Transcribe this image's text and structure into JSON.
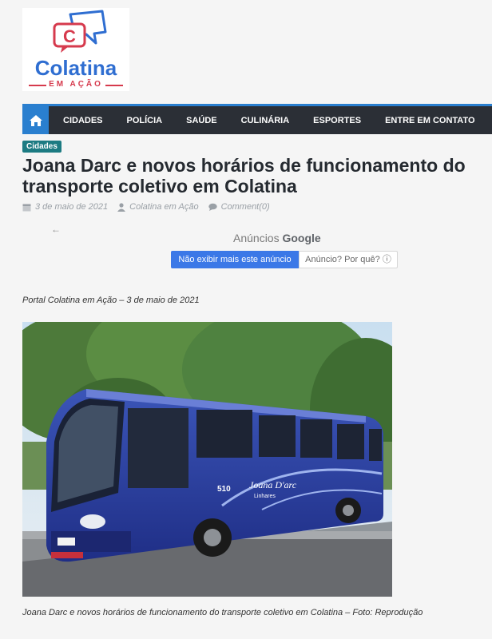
{
  "logo": {
    "word": "Colatina",
    "sub": "EM AÇÃO",
    "glyph": "C"
  },
  "nav": {
    "home_icon": "home-icon",
    "items": [
      "CIDADES",
      "POLÍCIA",
      "SAÚDE",
      "CULINÁRIA",
      "ESPORTES",
      "ENTRE EM CONTATO"
    ]
  },
  "article": {
    "category": "Cidades",
    "title": "Joana Darc e novos horários de funcionamento do transporte coletivo em Colatina",
    "date": "3 de maio de 2021",
    "author": "Colatina em Ação",
    "comments": "Comment(0)",
    "portal_line": "Portal Colatina em Ação – 3 de maio de 2021",
    "image": {
      "bus_number": "510",
      "bus_brand": "Joana D'arc",
      "bus_city": "Linhares"
    },
    "caption": "Joana Darc e novos horários de funcionamento do transporte coletivo em Colatina – Foto: Reprodução"
  },
  "ad": {
    "back": "←",
    "label_prefix": "Anúncios",
    "label_brand": "Google",
    "stop_button": "Não exibir mais este anúncio",
    "why_button": "Anúncio? Por quê?",
    "info_icon": "ⓘ"
  },
  "colors": {
    "nav_bg": "#2b2f36",
    "accent": "#2a7fcf",
    "badge": "#1c7b82",
    "logo_blue": "#2f6ed1",
    "logo_red": "#d63a4d"
  }
}
